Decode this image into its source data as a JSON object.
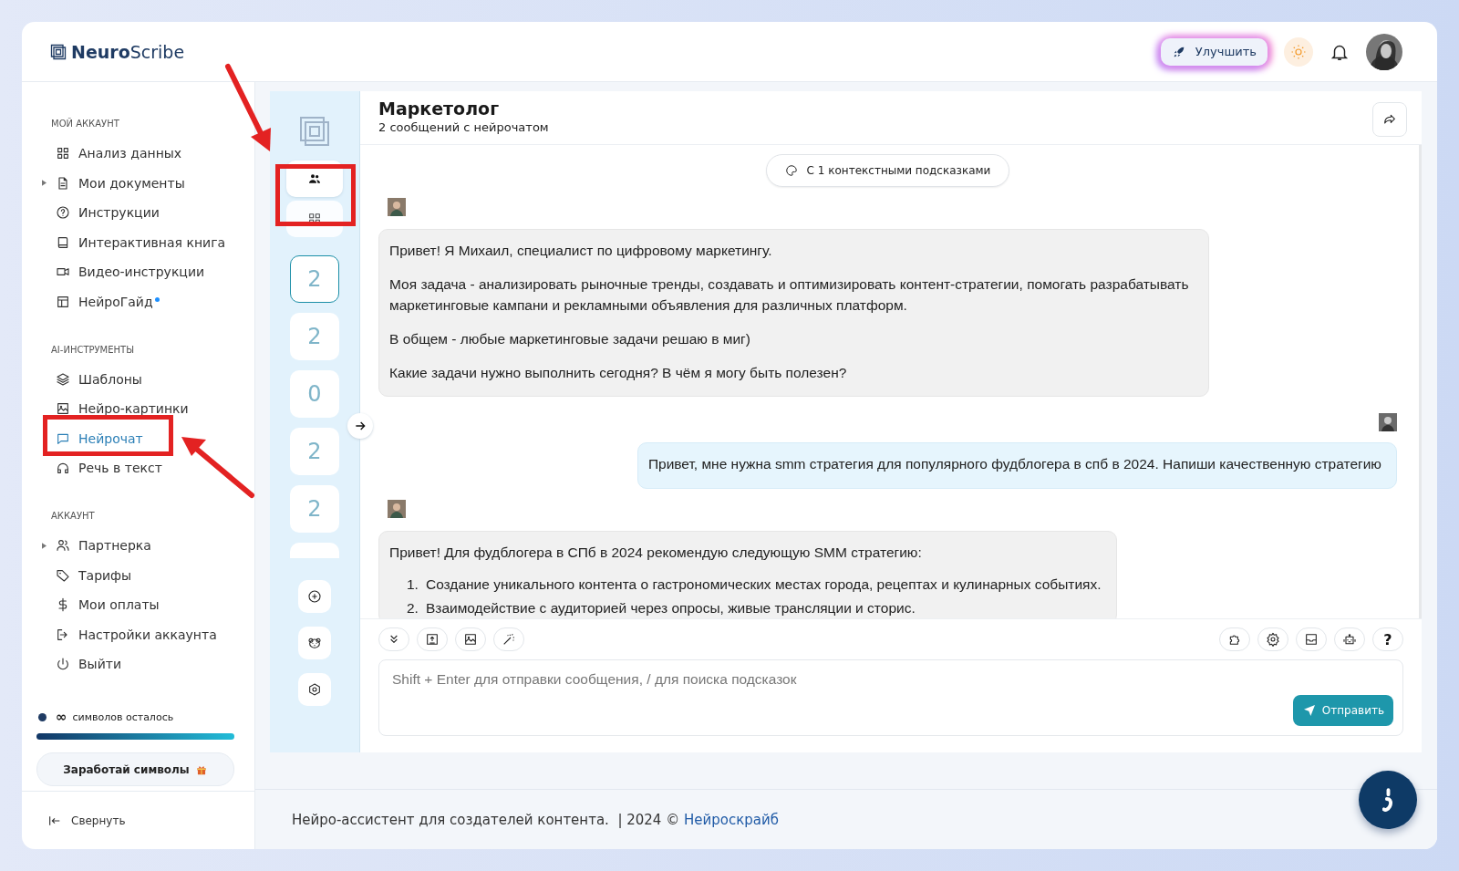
{
  "brand": {
    "bold": "Neuro",
    "light": "Scribe"
  },
  "header": {
    "upgrade_button": "Улучшить",
    "theme_light": true
  },
  "sidebar": {
    "sections": [
      {
        "title": "МОЙ АККАУНТ",
        "items": [
          {
            "label": "Анализ данных",
            "has_children": false,
            "new_dot": false,
            "selected": false
          },
          {
            "label": "Мои документы",
            "has_children": true,
            "new_dot": false,
            "selected": false
          },
          {
            "label": "Инструкции",
            "has_children": false,
            "new_dot": false,
            "selected": false
          },
          {
            "label": "Интерактивная книга",
            "has_children": false,
            "new_dot": false,
            "selected": false
          },
          {
            "label": "Видео-инструкции",
            "has_children": false,
            "new_dot": false,
            "selected": false
          },
          {
            "label": "НейроГайд",
            "has_children": false,
            "new_dot": true,
            "selected": false
          }
        ]
      },
      {
        "title": "AI-ИНСТРУМЕНТЫ",
        "items": [
          {
            "label": "Шаблоны",
            "has_children": false,
            "new_dot": false,
            "selected": false
          },
          {
            "label": "Нейро-картинки",
            "has_children": false,
            "new_dot": false,
            "selected": false
          },
          {
            "label": "Нейрочат",
            "has_children": false,
            "new_dot": false,
            "selected": true
          },
          {
            "label": "Речь в текст",
            "has_children": false,
            "new_dot": false,
            "selected": false
          }
        ]
      },
      {
        "title": "АККАУНТ",
        "items": [
          {
            "label": "Партнерка",
            "has_children": true,
            "new_dot": false,
            "selected": false
          },
          {
            "label": "Тарифы",
            "has_children": false,
            "new_dot": false,
            "selected": false
          },
          {
            "label": "Мои оплаты",
            "has_children": false,
            "new_dot": false,
            "selected": false
          },
          {
            "label": "Настройки аккаунта",
            "has_children": false,
            "new_dot": false,
            "selected": false
          },
          {
            "label": "Выйти",
            "has_children": false,
            "new_dot": false,
            "selected": false
          }
        ]
      }
    ],
    "symbols": {
      "amount": "∞",
      "label": "символов осталось",
      "level": 1
    },
    "earn_button": "Заработай символы",
    "collapse": "Свернуть"
  },
  "chat_list": {
    "tabs": [
      {
        "selected": true
      },
      {
        "selected": false
      }
    ],
    "chats": [
      {
        "count": "2",
        "selected": true
      },
      {
        "count": "2",
        "selected": false
      },
      {
        "count": "0",
        "selected": false
      },
      {
        "count": "2",
        "selected": false
      },
      {
        "count": "2",
        "selected": false
      }
    ]
  },
  "chat": {
    "title": "Маркетолог",
    "subtitle": "2 сообщений с нейрочатом",
    "hint_pill": "С 1 контекстными подсказками",
    "messages": [
      {
        "kind": "bot",
        "paragraphs": [
          "Привет! Я Михаил, специалист по цифровому маркетингу.",
          "Моя задача - анализировать рыночные тренды, создавать и оптимизировать контент-стратегии, помогать разрабатывать маркетинговые кампани и рекламными объявления для различных платформ.",
          "В общем - любые маркетинговые задачи решаю в миг)",
          "Какие задачи нужно выполнить сегодня? В чём я могу быть полезен?"
        ]
      },
      {
        "kind": "user",
        "paragraphs": [
          "Привет, мне нужна smm стратегия для популярного фудблогера в спб в 2024. Напиши качественную стратегию"
        ]
      },
      {
        "kind": "bot",
        "paragraphs": [
          "Привет! Для фудблогера в СПб в 2024 рекомендую следующую SMM стратегию:"
        ],
        "list": [
          {
            "number": "1.",
            "text": "Создание уникального контента о гастрономических местах города, рецептах и кулинарных событиях."
          },
          {
            "number": "2.",
            "text": "Взаимодействие с аудиторией через опросы, живые трансляции и сторис."
          }
        ]
      }
    ],
    "help_label": "?",
    "input": {
      "placeholder": "Shift + Enter для отправки сообщения, / для поиска подсказок"
    },
    "send_button": "Отправить"
  },
  "footer": {
    "text": "Нейро-ассистент для создателей контента.  | 2024 © ",
    "link": "Нейроскрайб"
  }
}
